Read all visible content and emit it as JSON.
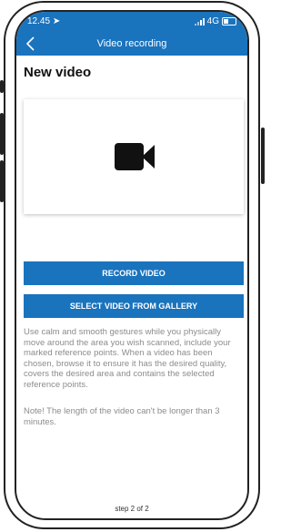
{
  "status": {
    "time": "12.45",
    "network": "4G"
  },
  "nav": {
    "title": "Video recording"
  },
  "page": {
    "title": "New video"
  },
  "buttons": {
    "record": "RECORD VIDEO",
    "gallery": "SELECT VIDEO FROM GALLERY"
  },
  "info": {
    "instructions": "Use calm and smooth gestures while you physically move around the area you wish scanned, include your marked reference points. When a video has been chosen, browse it to ensure it has the desired quality, covers the desired area and contains the selected reference points.",
    "note": "Note! The length of the video can't be longer than 3 minutes."
  },
  "footer": {
    "step": "step 2 of 2"
  },
  "colors": {
    "accent": "#1a73bd",
    "muted_text": "#8c8c8c"
  },
  "icons": {
    "back": "chevron-left-icon",
    "camera": "video-camera-icon"
  }
}
